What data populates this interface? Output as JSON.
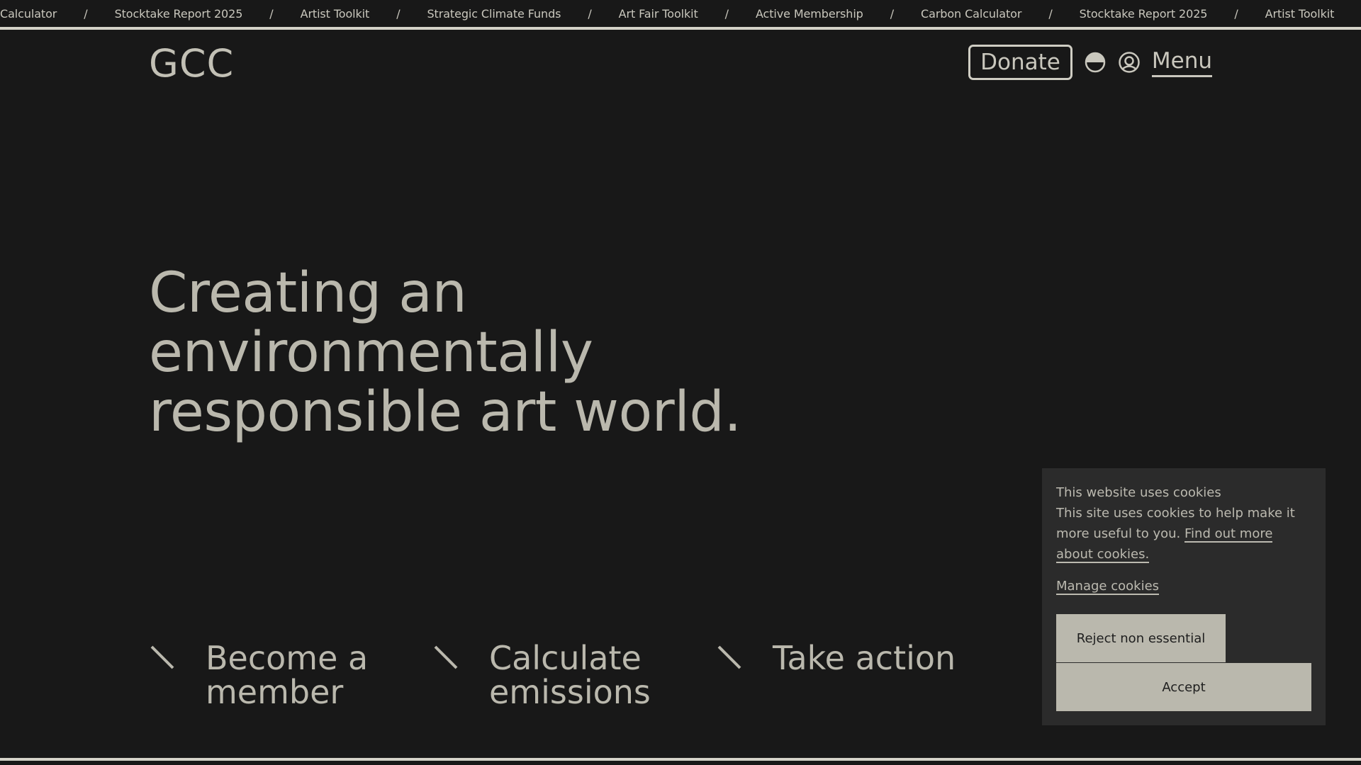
{
  "ticker": {
    "items": [
      "Calculator",
      "Stocktake Report 2025",
      "Artist Toolkit",
      "Strategic Climate Funds",
      "Art Fair Toolkit",
      "Active Membership",
      "Carbon Calculator",
      "Stocktake Report 2025",
      "Artist Toolkit"
    ],
    "separator": "/"
  },
  "header": {
    "logo": "GCC",
    "donate_label": "Donate",
    "menu_label": "Menu",
    "theme_icon": "half-circle-icon",
    "account_icon": "at-sign-icon"
  },
  "hero": {
    "title": "Creating an environmentally responsible art world."
  },
  "ctas": [
    {
      "label": "Become a member",
      "icon": "arrow-down-right-icon"
    },
    {
      "label": "Calculate emissions",
      "icon": "arrow-down-right-icon"
    },
    {
      "label": "Take action",
      "icon": "arrow-down-right-icon"
    }
  ],
  "cookies": {
    "heading": "This website uses cookies",
    "body": "This site uses cookies to help make it more useful to you.",
    "link_label": "Find out more about cookies.",
    "manage_label": "Manage cookies",
    "reject_label": "Reject non essential",
    "accept_label": "Accept"
  },
  "colors": {
    "background": "#181818",
    "text": "#bab8ad",
    "panel": "#2b2b2b"
  }
}
